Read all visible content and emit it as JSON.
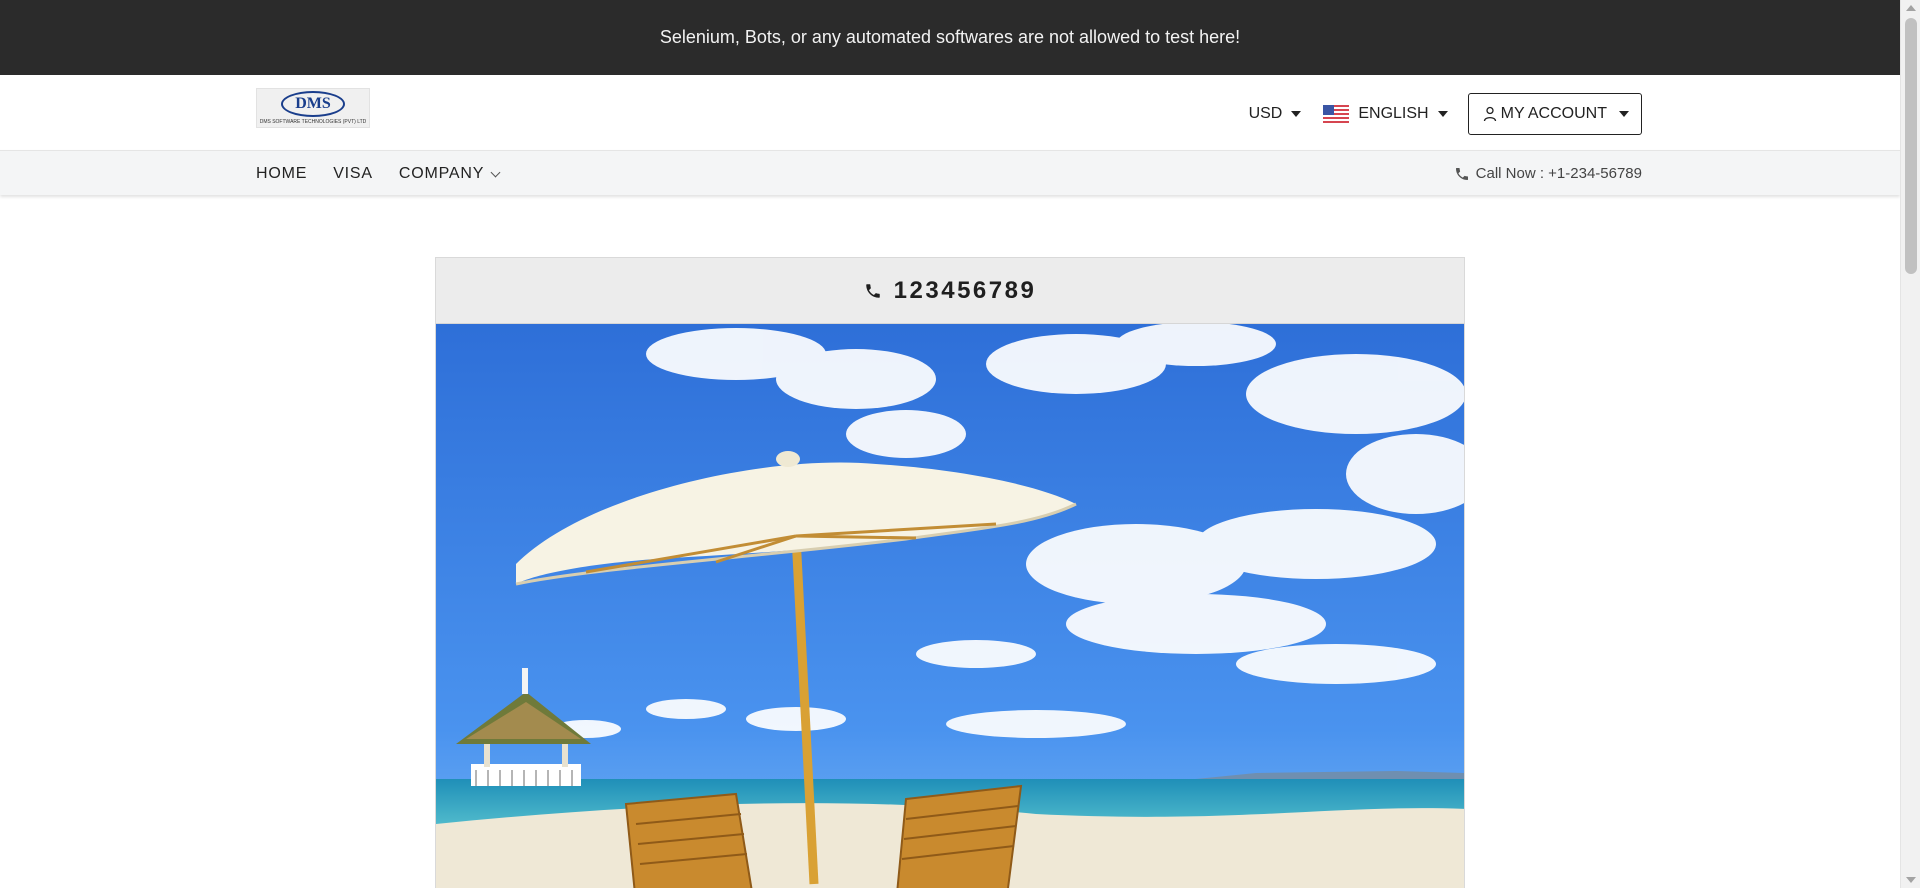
{
  "banner": {
    "text": "Selenium, Bots, or any automated softwares are not allowed to test here!"
  },
  "header": {
    "logo_text": "DMS",
    "logo_tagline": "DMS SOFTWARE TECHNOLOGIES (PVT) LTD",
    "currency": "USD",
    "language": "ENGLISH",
    "account_label": "MY ACCOUNT"
  },
  "nav": {
    "items": [
      {
        "label": "HOME"
      },
      {
        "label": "VISA"
      },
      {
        "label": "COMPANY"
      }
    ],
    "call_now": "Call Now : +1-234-56789"
  },
  "card": {
    "phone": "123456789"
  },
  "colors": {
    "banner_bg": "#2b2b2b",
    "nav_bg": "#f4f5f6",
    "logo_blue": "#1a3e8c"
  }
}
